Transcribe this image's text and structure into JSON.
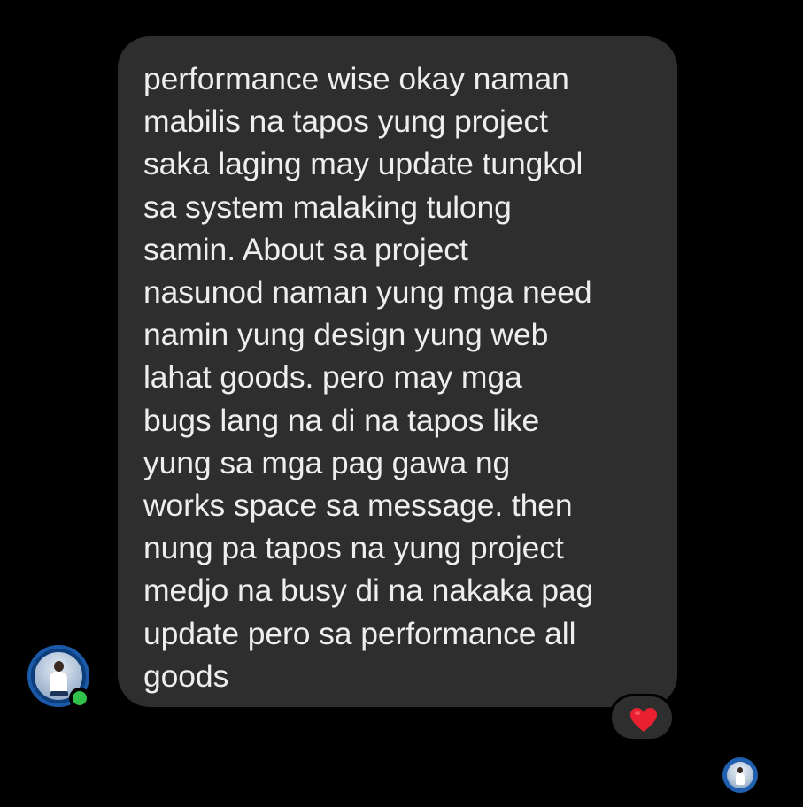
{
  "conversation": {
    "message": {
      "text": "performance wise okay naman\nmabilis na tapos yung project\nsaka laging may update tungkol\nsa system malaking tulong\nsamin. About sa project\nnasunod naman yung mga need\nnamin yung design yung web\nlahat goods. pero may mga\nbugs lang na di na tapos like\nyung sa mga pag gawa ng\nworks space sa message. then\nnung pa tapos na yung project\nmedjo na busy di na nakaka pag\nupdate pero sa performance all\ngoods",
      "reaction": {
        "icon": "heart-icon",
        "color": "#e8202f"
      }
    },
    "sender": {
      "avatar_icon": "profile-photo",
      "online_status_color": "#31c24a"
    },
    "read_receipt": {
      "avatar_icon": "profile-photo"
    },
    "colors": {
      "background": "#000000",
      "bubble": "#2e2e2e",
      "text": "#eeeeee"
    }
  }
}
